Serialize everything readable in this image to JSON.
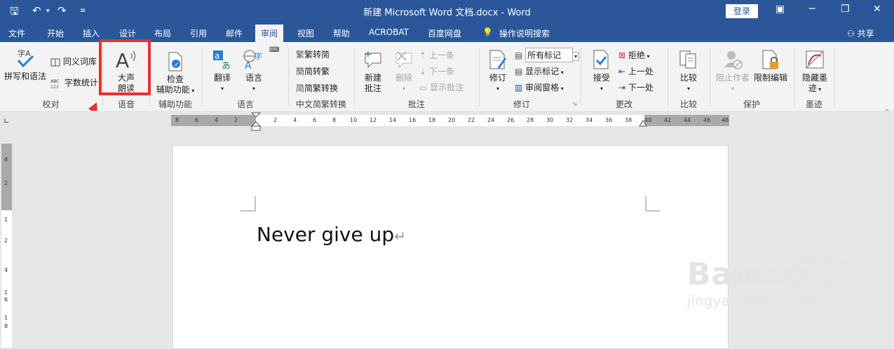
{
  "window": {
    "title": "新建 Microsoft Word 文档.docx  -  Word",
    "login": "登录"
  },
  "menu": {
    "items": [
      "文件",
      "开始",
      "插入",
      "设计",
      "布局",
      "引用",
      "邮件",
      "审阅",
      "视图",
      "帮助",
      "ACROBAT",
      "百度网盘"
    ],
    "tell_me": "操作说明搜索",
    "share": "共享",
    "active_index": 7
  },
  "ribbon": {
    "proofing": {
      "spelling": "拼写和语法",
      "thesaurus": "同义词库",
      "word_count": "字数统计",
      "label": "校对"
    },
    "speech": {
      "read_aloud_1": "大声",
      "read_aloud_2": "朗读",
      "label": "语音"
    },
    "accessibility": {
      "check_1": "检查",
      "check_2": "辅助功能",
      "label": "辅助功能"
    },
    "language": {
      "translate": "翻译",
      "language": "语言",
      "label": "语言"
    },
    "chinese": {
      "t2s": "繁转简",
      "s2t": "简转繁",
      "convert": "简繁转换",
      "label": "中文简繁转换"
    },
    "comments": {
      "new_1": "新建",
      "new_2": "批注",
      "delete": "删除",
      "prev": "上一条",
      "next": "下一条",
      "show": "显示批注",
      "label": "批注"
    },
    "tracking": {
      "track": "修订",
      "markup_select": "所有标记",
      "show_markup": "显示标记",
      "review_pane": "审阅窗格",
      "label": "修订"
    },
    "changes": {
      "accept": "接受",
      "reject": "拒绝",
      "prev": "上一处",
      "next": "下一处",
      "label": "更改"
    },
    "compare": {
      "compare": "比较",
      "label": "比较"
    },
    "protect": {
      "block": "阻止作者",
      "restrict": "限制编辑",
      "label": "保护"
    },
    "ink": {
      "hide_1": "隐藏墨",
      "hide_2": "迹",
      "label": "墨迹"
    }
  },
  "ruler": {
    "left_ticks": [
      "8",
      "6",
      "4",
      "2"
    ],
    "ticks": [
      "2",
      "4",
      "6",
      "8",
      "10",
      "12",
      "14",
      "16",
      "18",
      "20",
      "22",
      "24",
      "26",
      "28",
      "30",
      "32",
      "34",
      "36",
      "38",
      "40",
      "42",
      "44",
      "46",
      "48"
    ],
    "v_ticks": [
      "4",
      "2",
      "1",
      "2",
      "4",
      "1",
      "6",
      "1",
      "8"
    ]
  },
  "document": {
    "text": "Never give up"
  },
  "watermark": {
    "brand": "Baidu经验",
    "url": "jingyan.baidu.com"
  }
}
